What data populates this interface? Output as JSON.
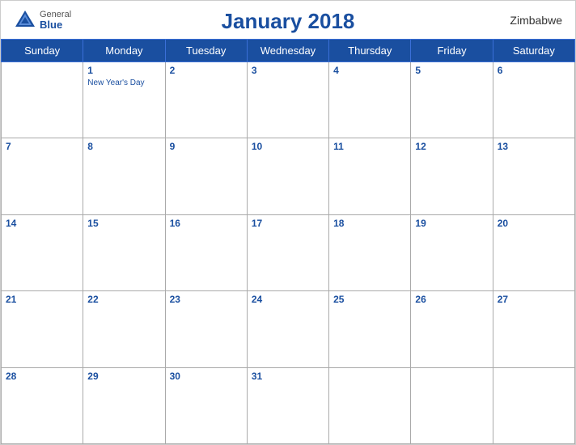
{
  "header": {
    "title": "January 2018",
    "country": "Zimbabwe",
    "logo": {
      "general": "General",
      "blue": "Blue"
    }
  },
  "weekdays": [
    "Sunday",
    "Monday",
    "Tuesday",
    "Wednesday",
    "Thursday",
    "Friday",
    "Saturday"
  ],
  "weeks": [
    [
      {
        "day": "",
        "empty": true
      },
      {
        "day": "1",
        "holiday": "New Year's Day"
      },
      {
        "day": "2",
        "holiday": ""
      },
      {
        "day": "3",
        "holiday": ""
      },
      {
        "day": "4",
        "holiday": ""
      },
      {
        "day": "5",
        "holiday": ""
      },
      {
        "day": "6",
        "holiday": ""
      }
    ],
    [
      {
        "day": "7",
        "holiday": ""
      },
      {
        "day": "8",
        "holiday": ""
      },
      {
        "day": "9",
        "holiday": ""
      },
      {
        "day": "10",
        "holiday": ""
      },
      {
        "day": "11",
        "holiday": ""
      },
      {
        "day": "12",
        "holiday": ""
      },
      {
        "day": "13",
        "holiday": ""
      }
    ],
    [
      {
        "day": "14",
        "holiday": ""
      },
      {
        "day": "15",
        "holiday": ""
      },
      {
        "day": "16",
        "holiday": ""
      },
      {
        "day": "17",
        "holiday": ""
      },
      {
        "day": "18",
        "holiday": ""
      },
      {
        "day": "19",
        "holiday": ""
      },
      {
        "day": "20",
        "holiday": ""
      }
    ],
    [
      {
        "day": "21",
        "holiday": ""
      },
      {
        "day": "22",
        "holiday": ""
      },
      {
        "day": "23",
        "holiday": ""
      },
      {
        "day": "24",
        "holiday": ""
      },
      {
        "day": "25",
        "holiday": ""
      },
      {
        "day": "26",
        "holiday": ""
      },
      {
        "day": "27",
        "holiday": ""
      }
    ],
    [
      {
        "day": "28",
        "holiday": ""
      },
      {
        "day": "29",
        "holiday": ""
      },
      {
        "day": "30",
        "holiday": ""
      },
      {
        "day": "31",
        "holiday": ""
      },
      {
        "day": "",
        "empty": true
      },
      {
        "day": "",
        "empty": true
      },
      {
        "day": "",
        "empty": true
      }
    ]
  ]
}
